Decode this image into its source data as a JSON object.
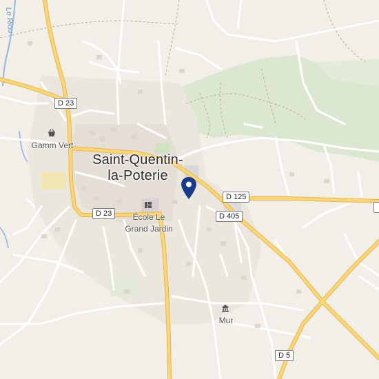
{
  "map": {
    "town_name_line1": "Saint-Quentin-",
    "town_name_line2": "la-Poterie",
    "river_label": "Le Riou",
    "roads": [
      {
        "id": "d23_north",
        "label": "D 23"
      },
      {
        "id": "d23_south",
        "label": "D 23"
      },
      {
        "id": "d125",
        "label": "D 125"
      },
      {
        "id": "d405",
        "label": "D 405"
      },
      {
        "id": "d5",
        "label": "D 5"
      }
    ],
    "pois": {
      "gamm_vert": "Gamm Vert",
      "ecole_line1": "École Le",
      "ecole_line2": "Grand Jardin",
      "mur": "Mur"
    },
    "colors": {
      "background": "#f2efe9",
      "main_road": "#f5c24e",
      "minor_road": "#ffffff",
      "forest": "#d9e6d0",
      "water": "#8fb6e6",
      "pin": "#1a3a8c"
    },
    "icons": {
      "pin": "location-pin-icon",
      "gamm_vert": "shopping-basket-icon",
      "ecole": "school-icon",
      "mur": "monument-icon"
    }
  }
}
